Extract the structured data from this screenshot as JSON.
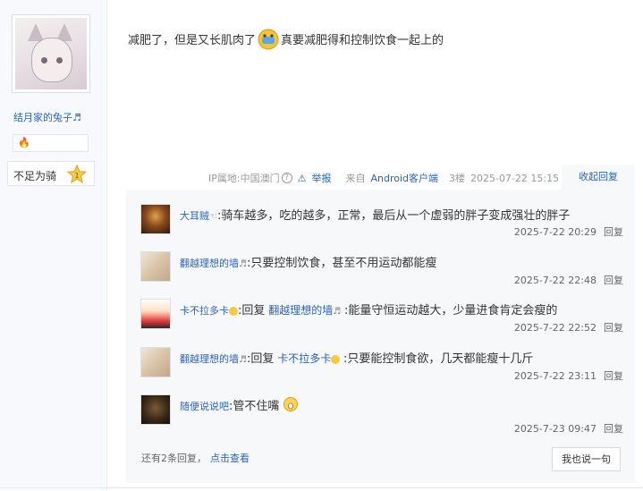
{
  "author": {
    "username": "结月家的兔子",
    "username_suffix_icon": "music-note-icon",
    "badge_icon": "flame-badge-icon",
    "level_name": "不足为骑",
    "level_number": "1"
  },
  "post": {
    "text_before_emoji": "减肥了，但是又长肌肉了",
    "emoji": "crying-face-emoji",
    "text_after_emoji": "真要减肥得和控制饮食一起上的"
  },
  "meta": {
    "ip_location": "IP属地:中国澳门",
    "report_label": "举报",
    "source_prefix": "来自",
    "source_client": "Android客户端",
    "floor": "3楼",
    "timestamp": "2025-07-22 15:15",
    "fold_reply_label": "收起回复"
  },
  "replies": [
    {
      "name": "大耳贼",
      "name_suffix": "☜",
      "reply_prefix": "",
      "reply_to": "",
      "content": ":骑车越多，吃的越多，正常，最后从一个虚弱的胖子变成强壮的胖子",
      "time": "2025-7-22 20:29",
      "reply_label": "回复"
    },
    {
      "name": "翻越理想的墙",
      "name_suffix": "♬",
      "reply_prefix": "",
      "reply_to": "",
      "content": ":只要控制饮食，甚至不用运动都能瘦",
      "time": "2025-7-22 22:48",
      "reply_label": "回复"
    },
    {
      "name": "卡不拉多卡",
      "name_suffix": "",
      "reply_prefix": ":回复",
      "reply_to": "翻越理想的墙",
      "content": ":能量守恒运动越大，少量进食肯定会瘦的",
      "time": "2025-7-22 22:52",
      "reply_label": "回复"
    },
    {
      "name": "翻越理想的墙",
      "name_suffix": "♬",
      "reply_prefix": ":回复",
      "reply_to": "卡不拉多卡",
      "content": ":只要能控制食欲，几天都能瘦十几斤",
      "time": "2025-7-22 23:11",
      "reply_label": "回复"
    },
    {
      "name": "随便说说吧",
      "name_suffix": "",
      "reply_prefix": "",
      "reply_to": "",
      "content": ":管不住嘴",
      "time": "2025-7-23 09:47",
      "reply_label": "回复"
    }
  ],
  "more": {
    "text": "还有2条回复，",
    "link": "点击查看",
    "say_button": "我也说一句"
  },
  "colors": {
    "link_blue": "#2d64b3",
    "panel_bg": "#f7f8fa"
  }
}
